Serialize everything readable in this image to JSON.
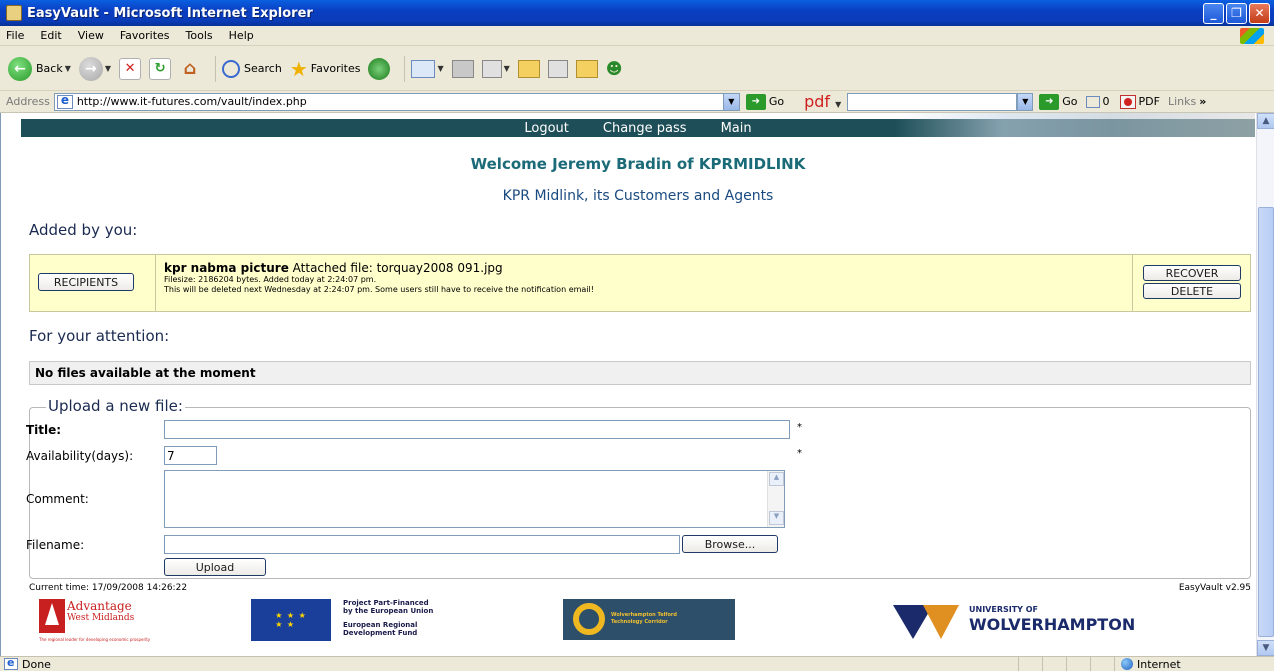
{
  "window": {
    "title": "EasyVault - Microsoft Internet Explorer"
  },
  "menu": [
    "File",
    "Edit",
    "View",
    "Favorites",
    "Tools",
    "Help"
  ],
  "toolbar": {
    "back": "Back",
    "search": "Search",
    "favorites": "Favorites"
  },
  "address": {
    "label": "Address",
    "url": "http://www.it-futures.com/vault/index.php",
    "go": "Go",
    "pdf_label": "pdf",
    "go2": "Go",
    "count": "0",
    "pdf_btn": "PDF",
    "links": "Links"
  },
  "nav": {
    "logout": "Logout",
    "change_pass": "Change pass",
    "main": "Main"
  },
  "page": {
    "welcome": "Welcome Jeremy Bradin of KPRMIDLINK",
    "subtitle": "KPR Midlink, its Customers and Agents",
    "added_by_you": "Added by you:",
    "for_attention": "For your attention:",
    "no_files": "No files available at the moment"
  },
  "added_item": {
    "recipients_btn": "RECIPIENTS",
    "title": "kpr nabma picture",
    "attached": "Attached file: torquay2008 091.jpg",
    "filesize": "Filesize: 2186204 bytes. Added today at 2:24:07 pm.",
    "deletion": "This will be deleted next Wednesday at 2:24:07 pm. Some users still have to receive the notification email!",
    "recover_btn": "RECOVER",
    "delete_btn": "DELETE"
  },
  "upload": {
    "legend": "Upload a new file:",
    "title_label": "Title:",
    "title_value": "",
    "availability_label": "Availability(days):",
    "availability_value": "7",
    "comment_label": "Comment:",
    "filename_label": "Filename:",
    "browse_btn": "Browse...",
    "upload_btn": "Upload",
    "required_mark": "*"
  },
  "footer": {
    "current_time": "Current time: 17/09/2008 14:26:22",
    "version": "EasyVault v2.95"
  },
  "logos": {
    "aw_line1": "Advantage",
    "aw_line2": "West Midlands",
    "aw_tagline": "The regional leader for developing economic prosperity",
    "eu_line1": "Project Part-Financed by the European Union",
    "eu_line2": "European Regional Development Fund",
    "wt_name": "Wolverhampton Telford Technology Corridor",
    "uw_of": "UNIVERSITY OF",
    "uw_name": "WOLVERHAMPTON"
  },
  "status": {
    "text": "Done",
    "zone": "Internet"
  }
}
